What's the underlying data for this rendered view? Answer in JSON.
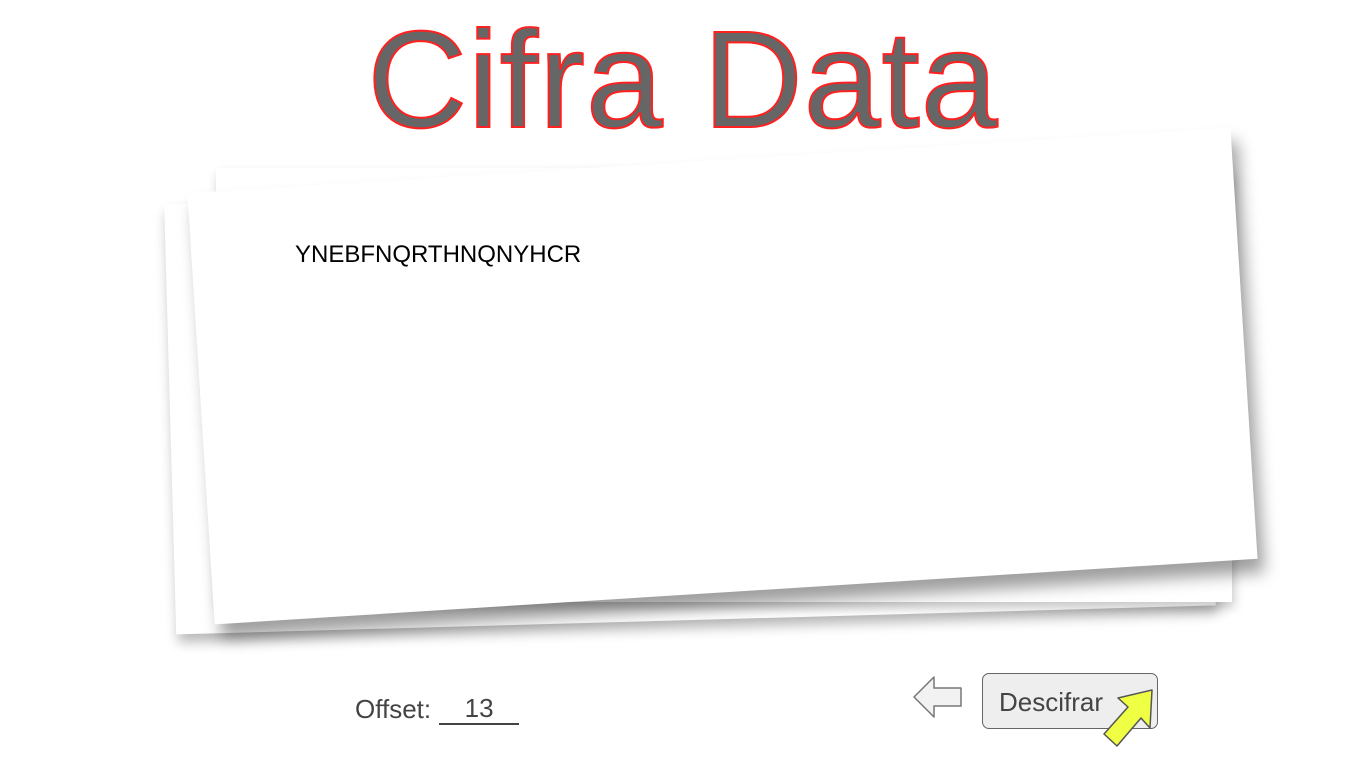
{
  "app": {
    "title": "Cifra Data",
    "title_fill_color": "#666666",
    "title_stroke_color": "#ff2020"
  },
  "editor": {
    "text": "YNEBFNQRTHNQNYHCR"
  },
  "controls": {
    "offset_label": "Offset:",
    "offset_value": "13",
    "decrypt_label": "Descifrar",
    "back_icon": "left-arrow-icon"
  },
  "cursor": {
    "icon": "arrow-cursor-icon",
    "color": "#eeff44"
  }
}
